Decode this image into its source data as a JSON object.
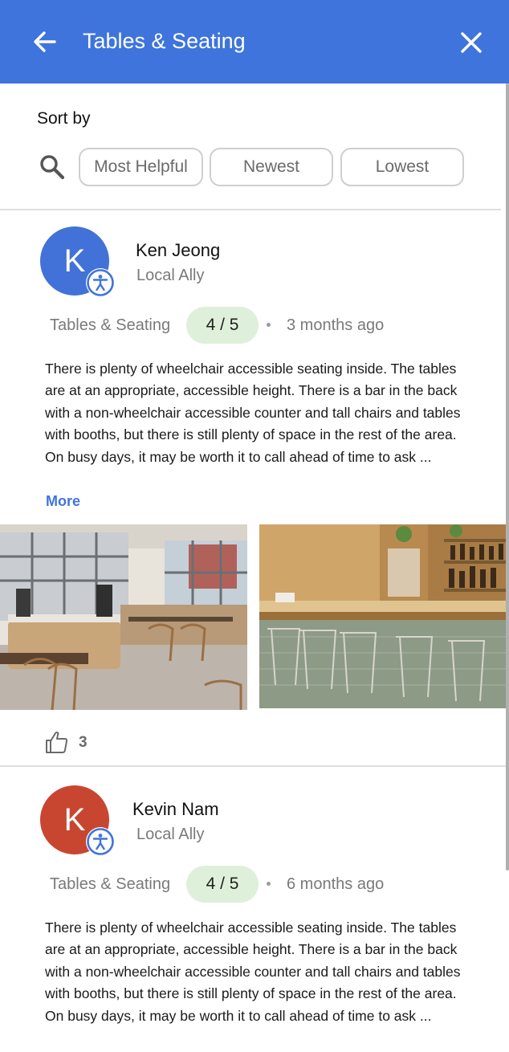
{
  "header": {
    "title": "Tables & Seating",
    "back_icon": "arrow-left-icon",
    "close_icon": "close-icon",
    "background": "#3f74dc"
  },
  "sort": {
    "label": "Sort by",
    "search_icon": "search-icon",
    "options": [
      "Most Helpful",
      "Newest",
      "Lowest"
    ]
  },
  "reviews": [
    {
      "avatar_letter": "K",
      "avatar_color": "#4272d7",
      "badge_icon": "accessibility-icon",
      "name": "Ken Jeong",
      "role": "Local Ally",
      "category": "Tables & Seating",
      "rating": "4 / 5",
      "time": "3 months ago",
      "text": "There is plenty of wheelchair accessible seating inside. The tables are at an appropriate, accessible height. There is a bar in the back with a non-wheelchair accessible counter and tall chairs and tables with booths, but there is still plenty of space in the rest of the area. On busy days, it may be worth it to call ahead of time to ask ...",
      "more_label": "More",
      "photos": [
        "cafe-interior-photo",
        "bar-counter-photo"
      ],
      "helpful_icon": "thumbs-up-icon",
      "helpful_count": "3"
    },
    {
      "avatar_letter": "K",
      "avatar_color": "#c84630",
      "badge_icon": "accessibility-icon",
      "name": "Kevin Nam",
      "role": "Local Ally",
      "category": "Tables & Seating",
      "rating": "4 / 5",
      "time": "6 months ago",
      "text": "There is plenty of wheelchair accessible seating inside. The tables are at an appropriate, accessible height. There is a bar in the back with a non-wheelchair accessible counter and tall chairs and tables with booths, but there is still plenty of space in the rest of the area. On busy days, it may be worth it to call ahead of time to ask ..."
    }
  ],
  "colors": {
    "accent": "#3f74dc",
    "rating_pill": "#dff0da",
    "muted_text": "#7a7a7a"
  }
}
